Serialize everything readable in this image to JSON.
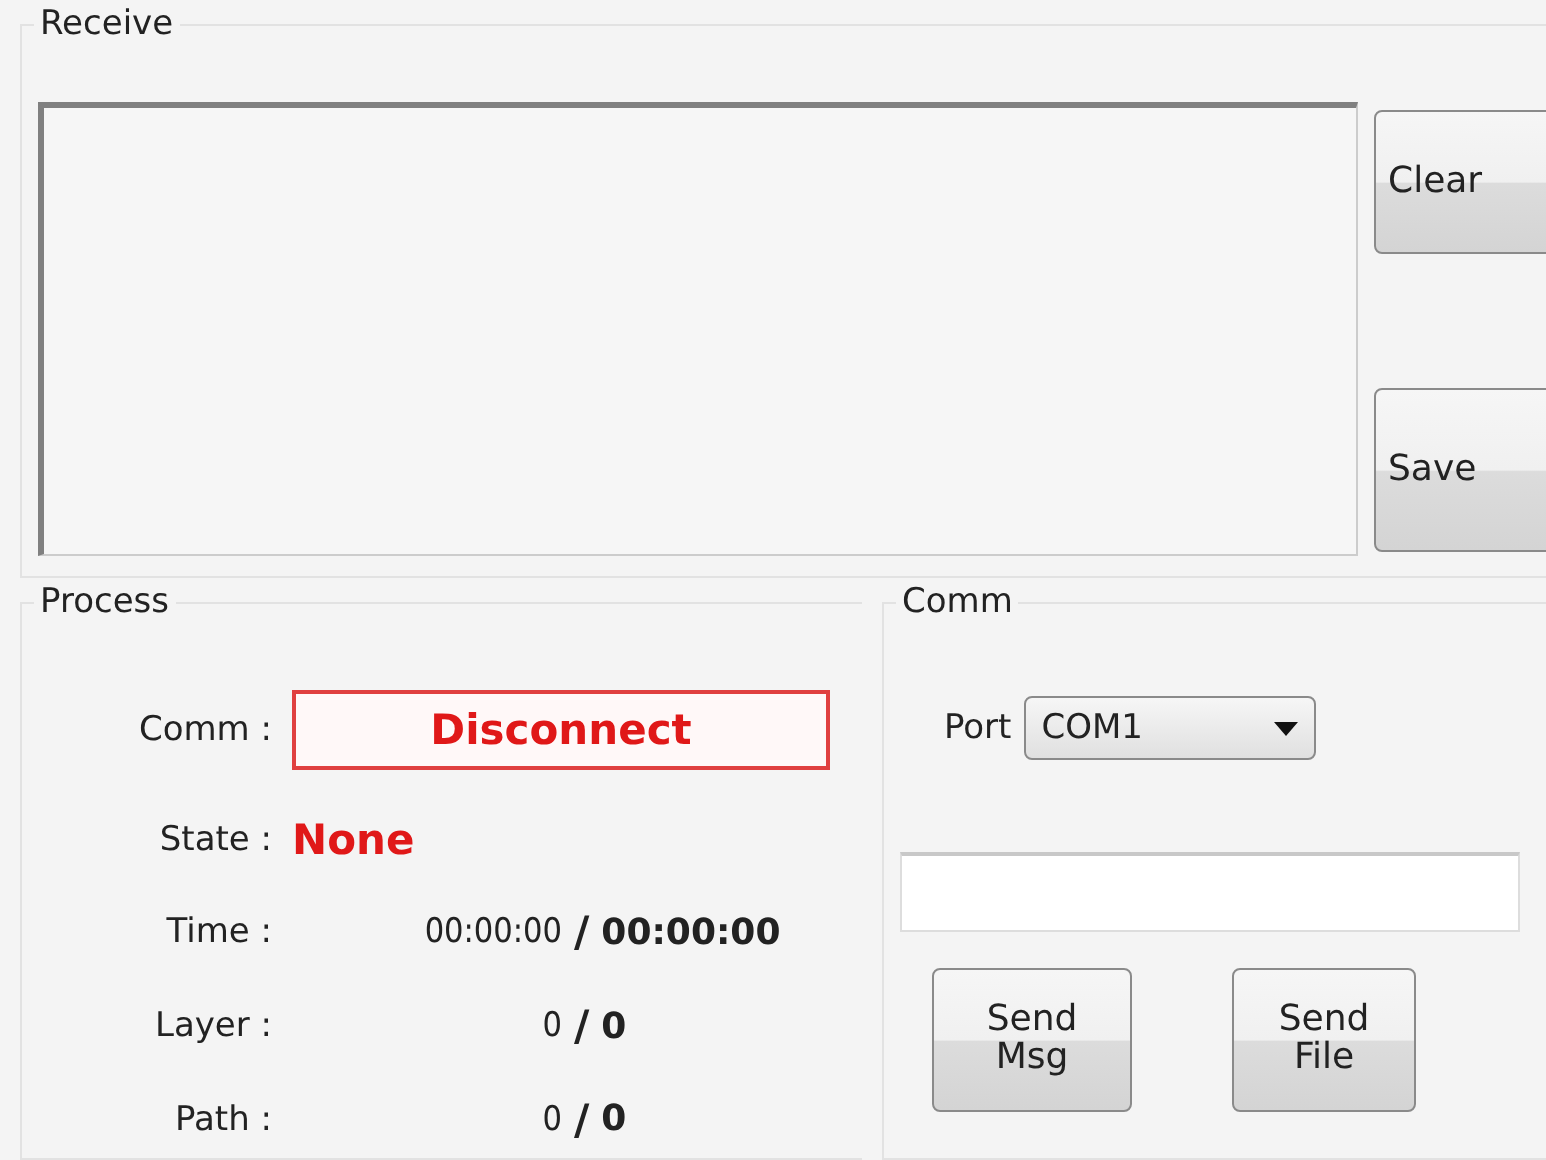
{
  "receive": {
    "title": "Receive",
    "buttons": [
      "Clear",
      "Save"
    ]
  },
  "process": {
    "title": "Process",
    "comm": {
      "label": "Comm :",
      "value": "Disconnect"
    },
    "state": {
      "label": "State :",
      "value": "None"
    },
    "rows": [
      {
        "label": "Time :",
        "current": "00:00:00",
        "separator": "/",
        "total": "00:00:00"
      },
      {
        "label": "Layer :",
        "current": "0",
        "separator": "/",
        "total": "0"
      },
      {
        "label": "Path :",
        "current": "0",
        "separator": "/",
        "total": "0"
      }
    ]
  },
  "comm": {
    "title": "Comm",
    "port_label": "Port",
    "port": "COM1",
    "buttons": [
      {
        "line1": "Send",
        "line2": "Msg"
      },
      {
        "line1": "Send",
        "line2": "File"
      }
    ]
  }
}
